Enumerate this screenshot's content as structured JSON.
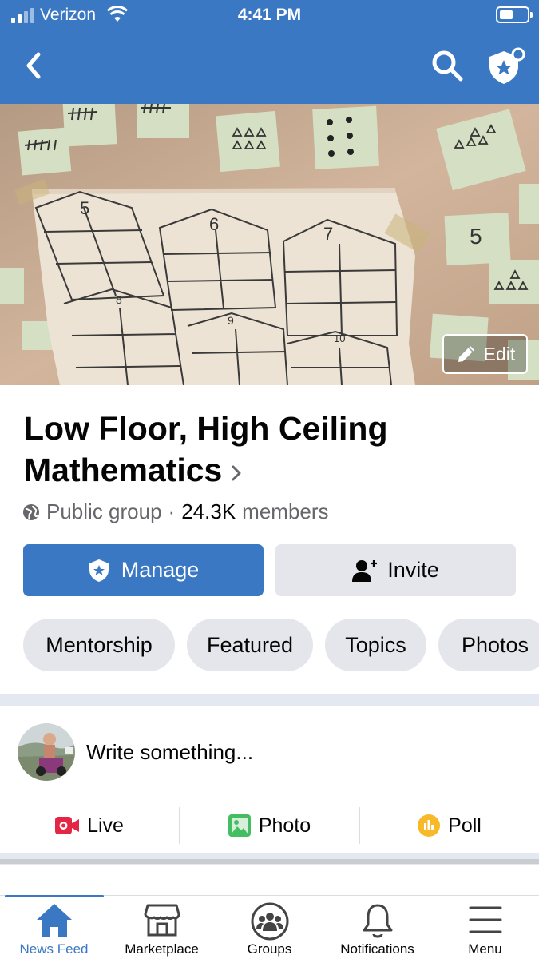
{
  "status_bar": {
    "carrier": "Verizon",
    "time": "4:41 PM"
  },
  "header": {
    "back_icon": "chevron-left-icon",
    "search_icon": "search-icon",
    "admin_icon": "shield-star-icon"
  },
  "cover": {
    "edit_label": "Edit",
    "sticky_numbers": [
      "5",
      "6",
      "7",
      "8",
      "9",
      "10",
      "5"
    ]
  },
  "group": {
    "title": "Low Floor, High Ceiling Mathematics",
    "privacy": "Public group",
    "separator": "·",
    "member_count": "24.3K",
    "members_label": "members"
  },
  "buttons": {
    "manage": "Manage",
    "invite": "Invite"
  },
  "chips": [
    "Mentorship",
    "Featured",
    "Topics",
    "Photos"
  ],
  "composer": {
    "placeholder": "Write something...",
    "actions": [
      {
        "label": "Live",
        "icon": "video-camera-icon"
      },
      {
        "label": "Photo",
        "icon": "photo-icon"
      },
      {
        "label": "Poll",
        "icon": "poll-icon"
      }
    ]
  },
  "tabbar": [
    {
      "label": "News Feed",
      "icon": "home-icon",
      "active": true
    },
    {
      "label": "Marketplace",
      "icon": "storefront-icon",
      "active": false
    },
    {
      "label": "Groups",
      "icon": "groups-icon",
      "active": false
    },
    {
      "label": "Notifications",
      "icon": "bell-icon",
      "active": false
    },
    {
      "label": "Menu",
      "icon": "hamburger-menu-icon",
      "active": false
    }
  ],
  "colors": {
    "brand": "#3b78c3",
    "chip_bg": "#e4e6eb",
    "secondary_text": "#65676b",
    "live_red": "#e42645",
    "photo_green": "#45bd62",
    "poll_orange": "#f7b928"
  }
}
